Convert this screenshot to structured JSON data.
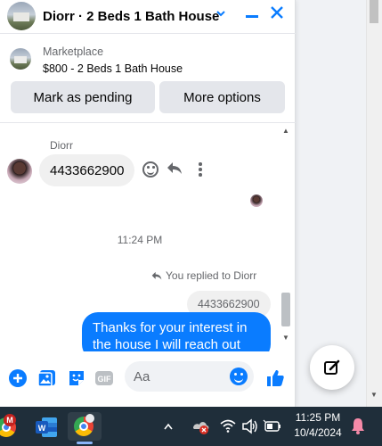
{
  "chat": {
    "title": "Diorr · 2 Beds 1 Bath House",
    "listing": {
      "category": "Marketplace",
      "info": "$800 - 2 Beds 1 Bath House"
    },
    "buttons": {
      "pending": "Mark as pending",
      "more": "More options"
    },
    "messages": {
      "sender_name": "Diorr",
      "incoming_text": "4433662900",
      "timestamp": "11:24 PM",
      "replied_note": "You replied to Diorr",
      "quoted_text": "4433662900",
      "outgoing_text": "Thanks for your interest in the house I will reach out"
    },
    "composer": {
      "placeholder": "Aa",
      "gif_label": "GIF"
    }
  },
  "taskbar": {
    "time": "11:25 PM",
    "date": "10/4/2024",
    "outlook_badge": "M"
  },
  "colors": {
    "accent": "#0a7cff",
    "bubble_in": "#f0f0f0",
    "taskbar": "#1f2e3a"
  }
}
